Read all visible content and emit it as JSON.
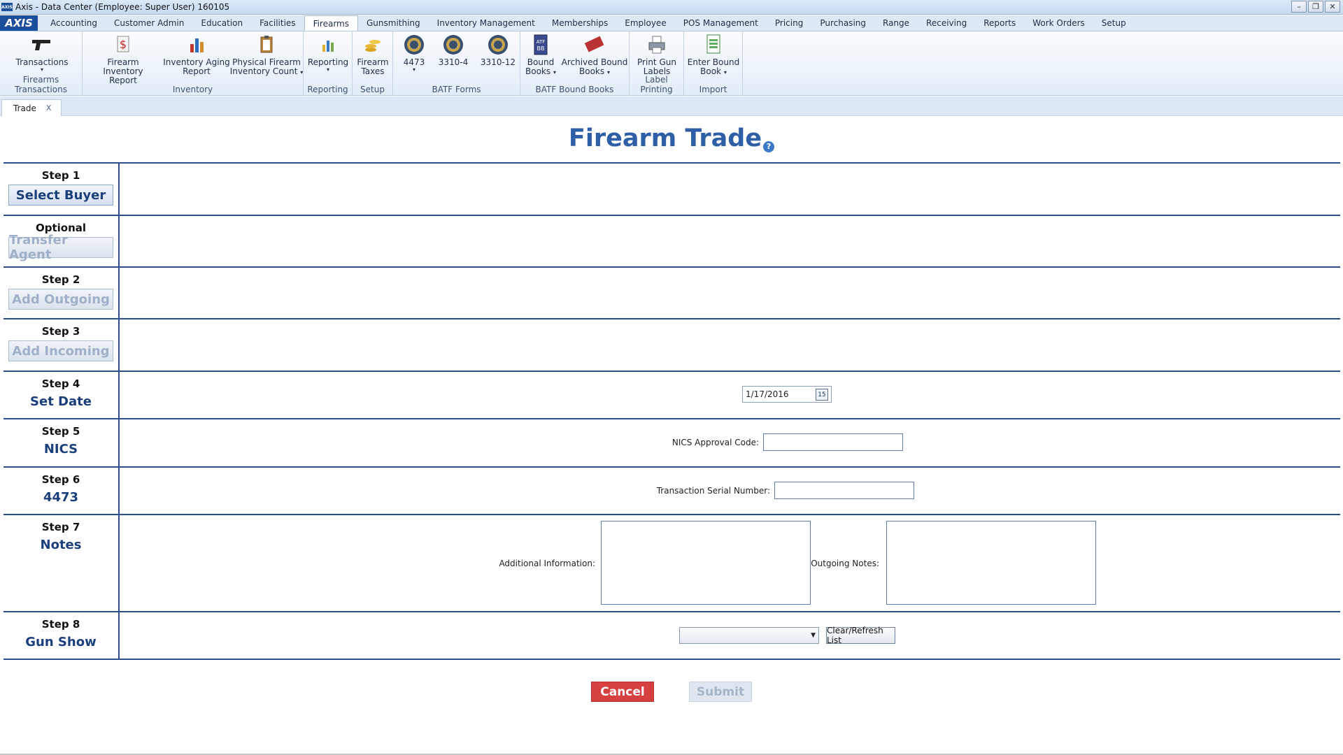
{
  "window": {
    "title": "Axis - Data Center  (Employee: Super User) 160105",
    "app_icon_text": "AXIS"
  },
  "menu": {
    "logo": "AXIS",
    "tabs": [
      "Accounting",
      "Customer Admin",
      "Education",
      "Facilities",
      "Firearms",
      "Gunsmithing",
      "Inventory Management",
      "Memberships",
      "Employee",
      "POS Management",
      "Pricing",
      "Purchasing",
      "Range",
      "Receiving",
      "Reports",
      "Work Orders",
      "Setup"
    ],
    "active_tab": "Firearms"
  },
  "ribbon": {
    "groups": {
      "firearms_transactions": "Firearms Transactions",
      "inventory": "Inventory",
      "reporting": "Reporting",
      "setup": "Setup",
      "batf_forms": "BATF Forms",
      "batf_bound_books": "BATF Bound Books",
      "label_printing": "Label Printing",
      "import": "Import"
    },
    "buttons": {
      "transactions": "Transactions",
      "firearm_inventory_report_1": "Firearm Inventory",
      "firearm_inventory_report_2": "Report",
      "inventory_aging_1": "Inventory Aging",
      "inventory_aging_2": "Report",
      "physical_count_1": "Physical Firearm",
      "physical_count_2": "Inventory Count",
      "reporting": "Reporting",
      "firearm_taxes_1": "Firearm",
      "firearm_taxes_2": "Taxes",
      "form_4473": "4473",
      "form_3310_4": "3310-4",
      "form_3310_12": "3310-12",
      "bound_books_1": "Bound",
      "bound_books_2": "Books",
      "archived_1": "Archived Bound",
      "archived_2": "Books",
      "print_labels_1": "Print Gun",
      "print_labels_2": "Labels",
      "enter_bound_1": "Enter Bound",
      "enter_bound_2": "Book"
    }
  },
  "doc_tab": {
    "label": "Trade",
    "close": "X"
  },
  "page": {
    "title": "Firearm Trade",
    "help": "?"
  },
  "steps": {
    "s1": {
      "num": "Step 1",
      "action": "Select Buyer"
    },
    "opt": {
      "num": "Optional",
      "action": "Transfer Agent"
    },
    "s2": {
      "num": "Step 2",
      "action": "Add Outgoing"
    },
    "s3": {
      "num": "Step 3",
      "action": "Add Incoming"
    },
    "s4": {
      "num": "Step 4",
      "action": "Set Date",
      "date_value": "1/17/2016",
      "calendar_icon_text": "15"
    },
    "s5": {
      "num": "Step 5",
      "action": "NICS",
      "field_label": "NICS Approval Code:",
      "field_value": ""
    },
    "s6": {
      "num": "Step 6",
      "action": "4473",
      "field_label": "Transaction Serial Number:",
      "field_value": ""
    },
    "s7": {
      "num": "Step 7",
      "action": "Notes",
      "additional_label": "Additional Information:",
      "outgoing_label": "Outgoing Notes:"
    },
    "s8": {
      "num": "Step 8",
      "action": "Gun Show",
      "select_value": "",
      "refresh_label": "Clear/Refresh List"
    }
  },
  "actions": {
    "cancel": "Cancel",
    "submit": "Submit"
  },
  "colors": {
    "accent": "#2d5ea6",
    "cancel": "#d64040",
    "divider": "#2a4f8a"
  }
}
